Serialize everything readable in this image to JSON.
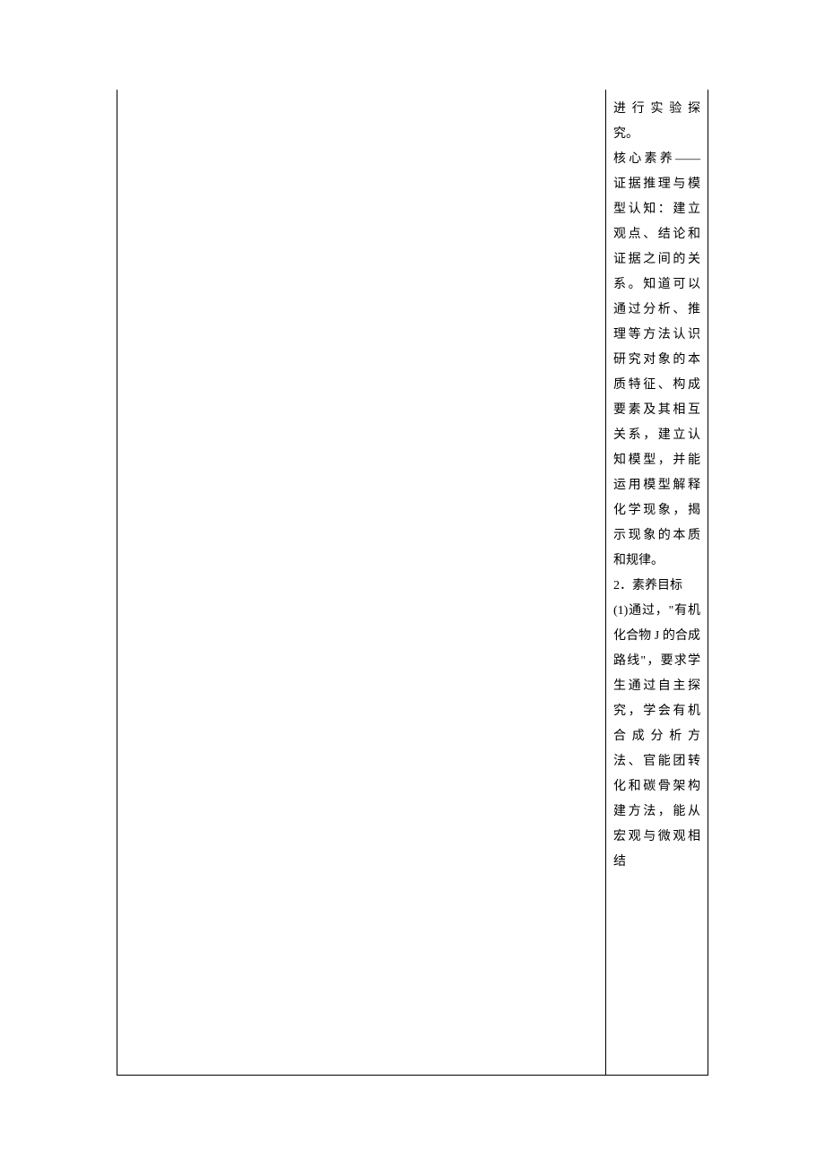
{
  "table": {
    "rightColumn": {
      "lines": [
        "进行实验探究。",
        "核心素养——证据推理与模型认知：建立观点、结论和证据之间的关系。知道可以通过分析、推理等方法认识研究对象的本质特征、构成要素及其相互关系，建立认知模型，并能运用模型解释化学现象，揭示现象的本质和规律。",
        "2．素养目标",
        "(1)通过，\"有机化合物 J 的合成路线\"，要求学生通过自主探究，学会有机合成分析方法、官能团转化和碳骨架构建方法，能从宏观与微观相结"
      ]
    }
  }
}
